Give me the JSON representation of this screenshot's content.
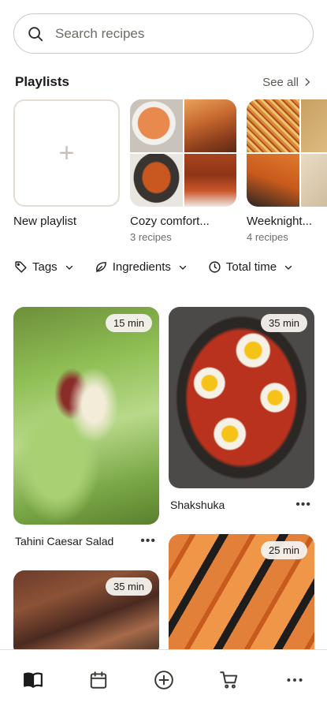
{
  "search": {
    "placeholder": "Search recipes",
    "icon": "search-icon"
  },
  "playlists": {
    "title": "Playlists",
    "see_all": "See all",
    "items": [
      {
        "name": "New playlist",
        "count": ""
      },
      {
        "name": "Cozy comfort...",
        "count": "3 recipes"
      },
      {
        "name": "Weeknight...",
        "count": "4 recipes"
      }
    ]
  },
  "filters": [
    {
      "label": "Tags",
      "icon": "tag-icon"
    },
    {
      "label": "Ingredients",
      "icon": "leaf-icon"
    },
    {
      "label": "Total time",
      "icon": "clock-icon"
    }
  ],
  "recipes": [
    {
      "title": "Tahini Caesar Salad",
      "time": "15 min"
    },
    {
      "title": "Shakshuka",
      "time": "35 min"
    },
    {
      "title": "",
      "time": "35 min"
    },
    {
      "title": "",
      "time": "25 min"
    }
  ],
  "nav": {
    "tabs": [
      "book-icon",
      "calendar-icon",
      "plus-circle-icon",
      "cart-icon",
      "more-icon"
    ],
    "active": "book-icon"
  },
  "colors": {
    "accent": "#1c1b1a",
    "muted": "#6f6b66",
    "border": "#c9c6c2"
  }
}
